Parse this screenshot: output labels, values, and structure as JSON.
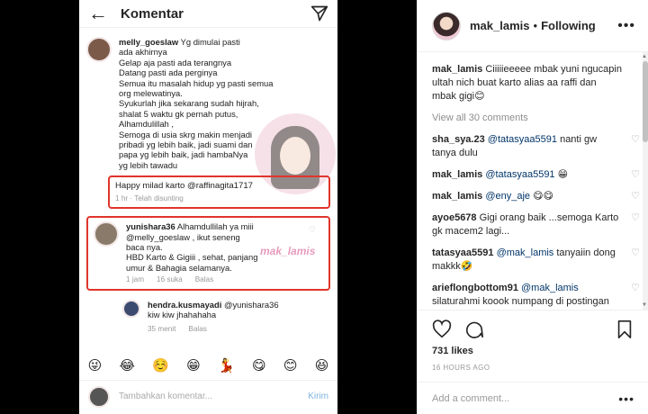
{
  "screenshot": {
    "header_title": "Komentar",
    "comments": [
      {
        "user": "melly_goeslaw",
        "text": "Yg dimulai pasti\nada akhirnya\nGelap aja pasti ada terangnya\nDatang pasti ada perginya\nSemua itu masalah hidup yg pasti semua\norg melewatinya.\nSyukurlah jika sekarang sudah hijrah,\nshalat 5 waktu gk pernah putus,\nAlhamdulillah ,\nSemoga di usia skrg makin menjadi\npribadi yg lebih baik, jadi suami dan\npapa yg lebih baik, jadi hambaNya\nyg lebih tawadu",
        "highlight": "Happy milad karto @raffinagita1717",
        "meta": "1 hr · Telah disunting"
      },
      {
        "user": "yunishara36",
        "text": "Alhamdullilah ya miii\n@melly_goeslaw , ikut seneng\nbaca nya.\nHBD Karto & Gigiii , sehat, panjang\numur & Bahagia selamanya.",
        "meta_time": "1 jam",
        "meta_likes": "16 suka",
        "meta_reply": "Balas"
      },
      {
        "user": "hendra.kusmayadi",
        "mention": "@yunishara36",
        "text": "kiw kiw jhahahaha",
        "meta_time": "35 menit",
        "meta_reply": "Balas"
      }
    ],
    "watermark_text": "mak_lamis",
    "emojis": [
      "😜",
      "😂",
      "☺️",
      "😁",
      "💃",
      "😋",
      "😊",
      "😆"
    ],
    "input_placeholder": "Tambahkan komentar...",
    "send_label": "Kirim"
  },
  "sidebar": {
    "username": "mak_lamis",
    "separator": "•",
    "follow_status": "Following",
    "more_icon": "•••",
    "caption_user": "mak_lamis",
    "caption_text": "Ciiiiieeeee mbak yuni ngucapin ultah nich buat karto alias aa raffi dan mbak gigi😊",
    "view_all": "View all 30 comments",
    "comments": [
      {
        "user": "sha_sya.23",
        "mention": "@tatasyaa5591",
        "text": " nanti gw tanya dulu"
      },
      {
        "user": "mak_lamis",
        "mention": "@tatasyaa5591",
        "text": " 😁"
      },
      {
        "user": "mak_lamis",
        "mention": "@eny_aje",
        "text": " 😋😋"
      },
      {
        "user": "ayoe5678",
        "mention": "",
        "text": "Gigi orang baik ...semoga Karto gk macem2 lagi..."
      },
      {
        "user": "tatasyaa5591",
        "mention": "@mak_lamis",
        "text": " tanyaiin dong makkk🤣"
      },
      {
        "user": "arieflongbottom91",
        "mention": "@mak_lamis",
        "text": " silaturahmi koook numpang di postingan orang lain yeeeeesssss? Bukannya bikin sendiriiii. Ya khaaaaaaaaaaaaaaaaaaan? 🙈"
      }
    ],
    "likes": "731 likes",
    "time": "16 HOURS AGO",
    "add_comment_placeholder": "Add a comment...",
    "add_more_icon": "•••"
  }
}
